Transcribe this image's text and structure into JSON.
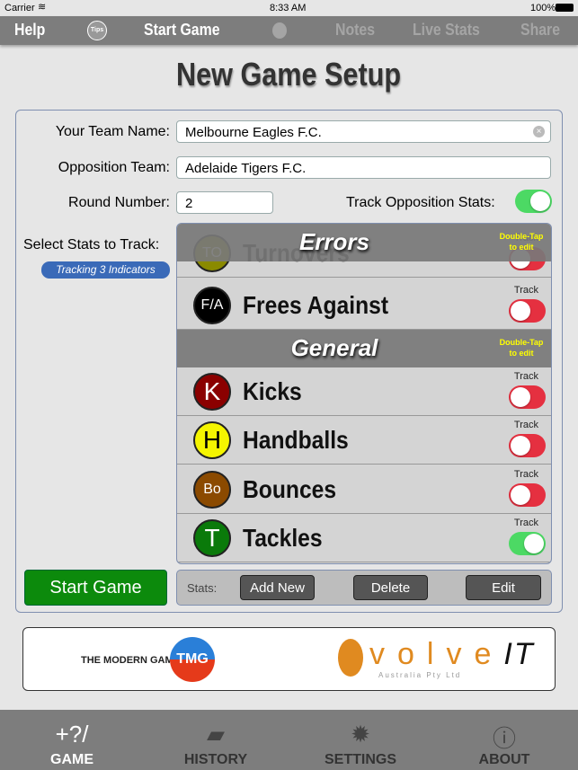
{
  "status": {
    "carrier": "Carrier",
    "time": "8:33 AM",
    "battery": "100%"
  },
  "nav": {
    "help": "Help",
    "tips": "Tips",
    "start_game": "Start Game",
    "notes": "Notes",
    "live_stats": "Live Stats",
    "share": "Share"
  },
  "title": "New Game Setup",
  "form": {
    "team_label": "Your Team Name:",
    "team_value": "Melbourne Eagles F.C.",
    "opp_label": "Opposition Team:",
    "opp_value": "Adelaide Tigers F.C.",
    "round_label": "Round Number:",
    "round_value": "2",
    "track_opp_label": "Track Opposition Stats:",
    "track_opp_on": true,
    "select_label": "Select Stats to Track:",
    "tracking_badge": "Tracking 3 Indicators"
  },
  "stats": {
    "double_tap": "Double-Tap to edit",
    "track": "Track",
    "sections": [
      {
        "title": "Errors"
      },
      {
        "title": "General"
      }
    ],
    "items": [
      {
        "abbr": "TO",
        "name": "Turnovers",
        "color": "#8a8a00",
        "on": false
      },
      {
        "abbr": "F/A",
        "name": "Frees Against",
        "color": "#000000",
        "on": false
      },
      {
        "abbr": "K",
        "name": "Kicks",
        "color": "#8b0000",
        "on": false
      },
      {
        "abbr": "H",
        "name": "Handballs",
        "color": "#f5f500",
        "on": false
      },
      {
        "abbr": "Bo",
        "name": "Bounces",
        "color": "#8b4a00",
        "on": false
      },
      {
        "abbr": "T",
        "name": "Tackles",
        "color": "#0a7a0a",
        "on": true
      }
    ]
  },
  "buttons": {
    "start_game": "Start Game",
    "stats_label": "Stats:",
    "add_new": "Add New",
    "delete": "Delete",
    "edit": "Edit"
  },
  "logos": {
    "tmg": "THE MODERN GAME TMG",
    "evolve": "evolve IT Australia Pty Ltd"
  },
  "tabs": [
    {
      "label": "GAME",
      "icon": "game-icon"
    },
    {
      "label": "HISTORY",
      "icon": "history-folder-icon"
    },
    {
      "label": "SETTINGS",
      "icon": "gear-icon"
    },
    {
      "label": "ABOUT",
      "icon": "info-icon"
    }
  ]
}
